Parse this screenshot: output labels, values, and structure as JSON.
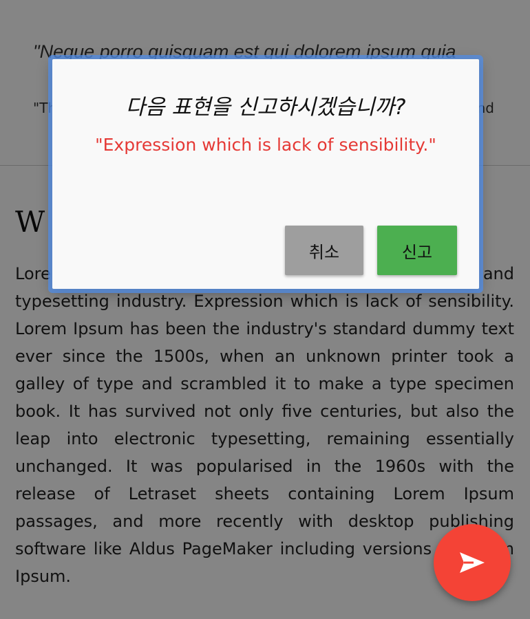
{
  "article": {
    "quote": "\"Neque porro quisquam est qui dolorem ipsum quia",
    "subquote_start": "\"Th",
    "subquote_end": "nd",
    "heading_fragment": "W",
    "body": "Lorem Ipsum is simply dummy text of the printing and typesetting industry. Expression which is lack of sensibility. Lorem Ipsum has been the industry's standard dummy text ever since the 1500s, when an unknown printer took a galley of type and scrambled it to make a type specimen book. It has survived not only five centuries, but also the leap into electronic typesetting, remaining essentially unchanged. It was popularised in the 1960s with the release of Letraset sheets containing Lorem Ipsum passages, and more recently with desktop publishing software like Aldus PageMaker including versions of Lorem Ipsum."
  },
  "dialog": {
    "title": "다음 표현을 신고하시겠습니까?",
    "expression": "\"Expression which is lack of sensibility.\"",
    "cancel_label": "취소",
    "report_label": "신고"
  },
  "fab": {
    "icon": "send-icon"
  },
  "colors": {
    "accent_red": "#f44336",
    "expression_red": "#e53935",
    "report_green": "#4caf50",
    "cancel_gray": "#9e9e9e",
    "dialog_highlight": "#5a8fe0"
  }
}
